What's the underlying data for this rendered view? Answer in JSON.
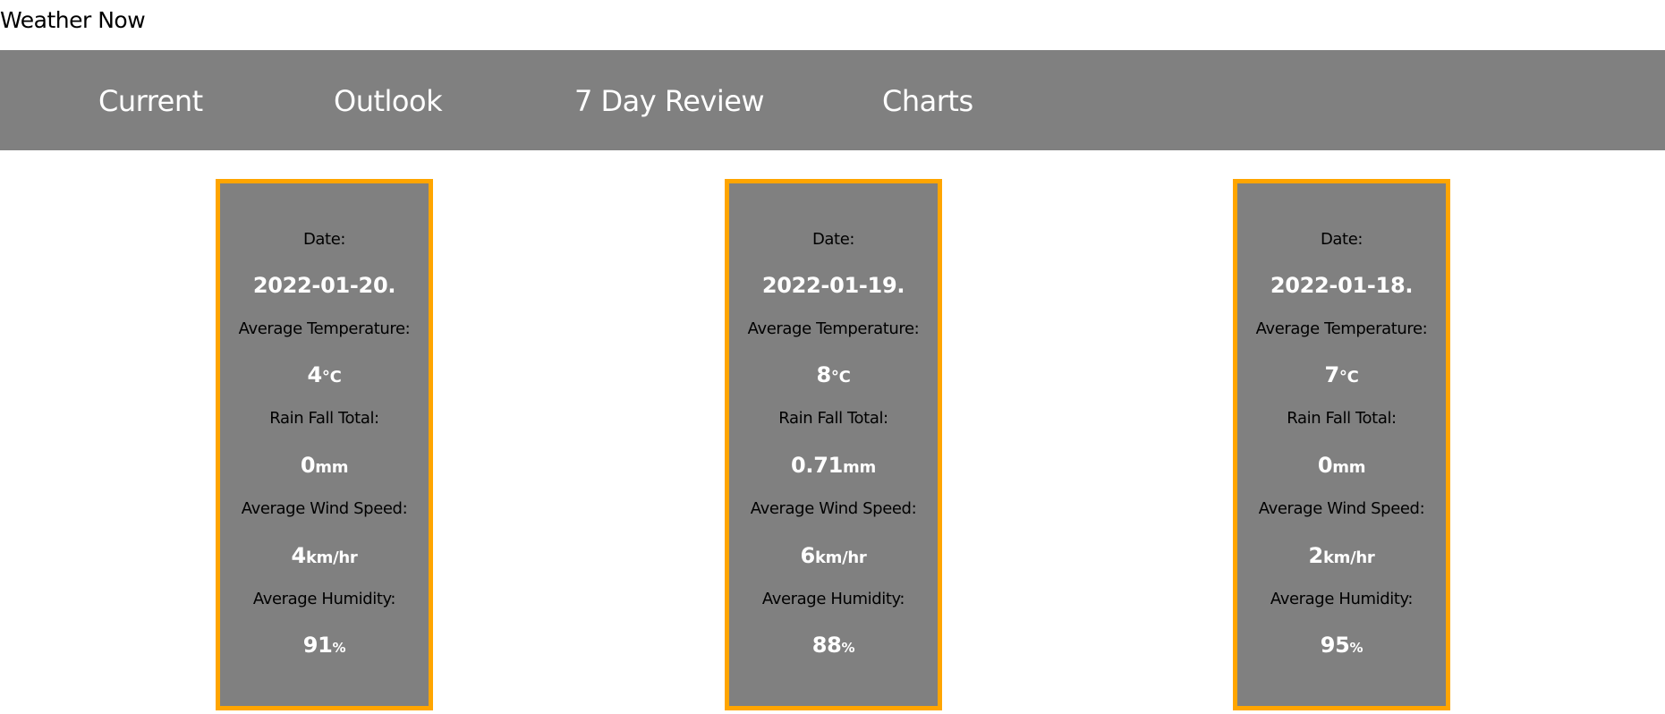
{
  "site": {
    "title": "Weather Now"
  },
  "nav": {
    "items": [
      {
        "label": "Current"
      },
      {
        "label": "Outlook"
      },
      {
        "label": "7 Day Review"
      },
      {
        "label": "Charts"
      }
    ]
  },
  "labels": {
    "date": "Date:",
    "avg_temp": "Average Temperature:",
    "rain": "Rain Fall Total:",
    "wind": "Average Wind Speed:",
    "humidity": "Average Humidity:"
  },
  "units": {
    "temp": "°C",
    "rain": "mm",
    "wind": "km/hr",
    "humidity": "%"
  },
  "cards": [
    {
      "date": "2022-01-20.",
      "temp": "4",
      "rain": "0",
      "wind": "4",
      "humidity": "91"
    },
    {
      "date": "2022-01-19.",
      "temp": "8",
      "rain": "0.71",
      "wind": "6",
      "humidity": "88"
    },
    {
      "date": "2022-01-18.",
      "temp": "7",
      "rain": "0",
      "wind": "2",
      "humidity": "95"
    }
  ],
  "colors": {
    "nav_bg": "#808080",
    "card_bg": "#808080",
    "card_border": "#ffa500",
    "text_light": "#ffffff",
    "text_dark": "#000000"
  }
}
